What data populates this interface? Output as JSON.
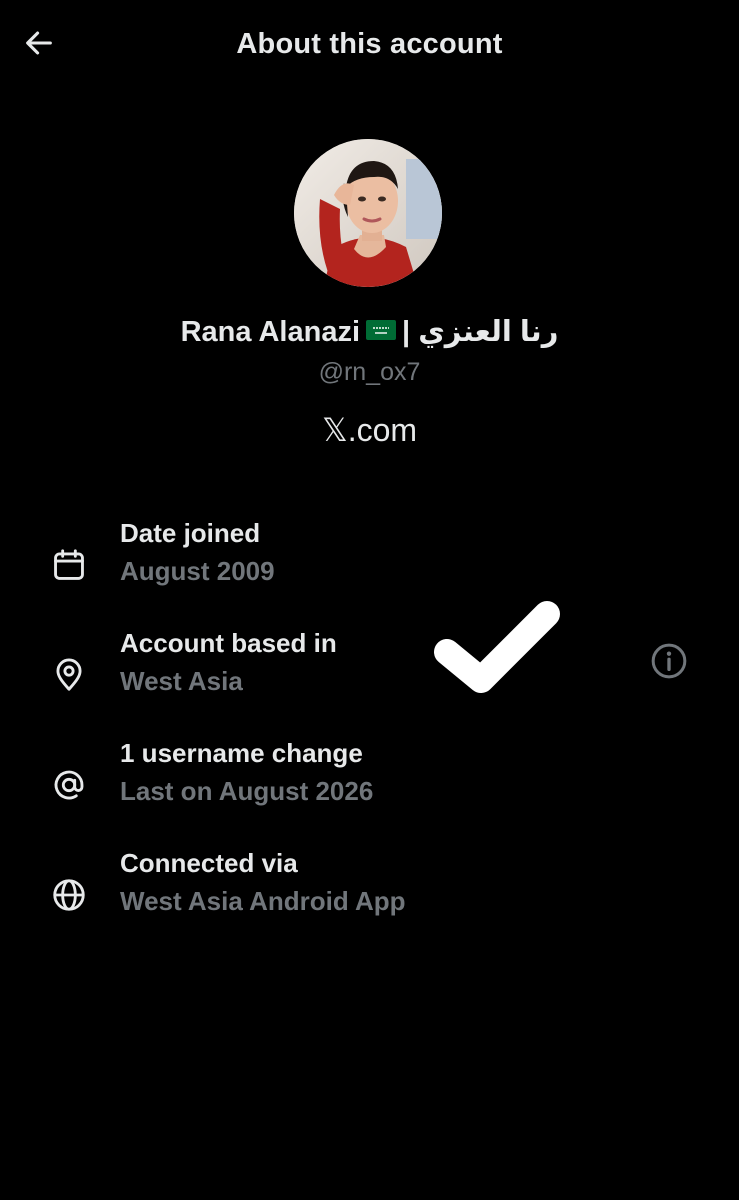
{
  "header": {
    "title": "About this account",
    "back_icon": "arrow-left-icon"
  },
  "profile": {
    "name_prefix": "Rana Alanazi",
    "flag_icon": "saudi-flag-icon",
    "name_suffix": "| رنا العنزي",
    "handle": "@rn_ox7",
    "domain": "𝕏.com"
  },
  "rows": [
    {
      "icon": "calendar-icon",
      "label": "Date joined",
      "value": "August 2009"
    },
    {
      "icon": "location-pin-icon",
      "label": "Account based in",
      "value": "West Asia"
    },
    {
      "icon": "at-sign-icon",
      "label": "1 username change",
      "value": "Last on August 2026"
    },
    {
      "icon": "globe-icon",
      "label": "Connected via",
      "value": "West Asia Android App"
    }
  ],
  "info_icon": "info-icon",
  "overlay_icon": "checkmark-icon",
  "colors": {
    "background": "#000000",
    "primary_text": "#e7e9ea",
    "secondary_text": "#71767b",
    "flag_green": "#006c35"
  }
}
